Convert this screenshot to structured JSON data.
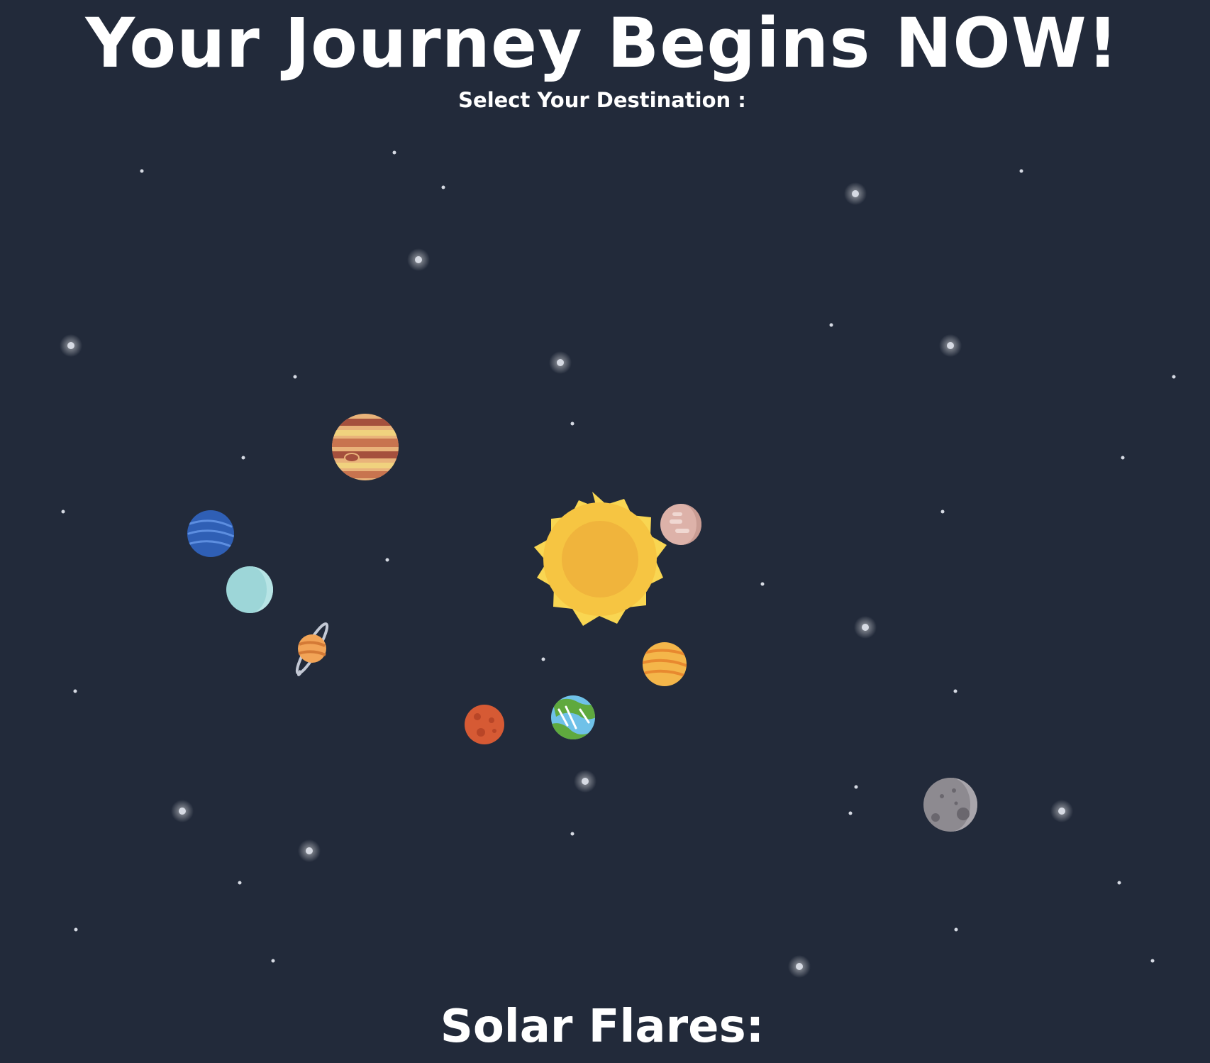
{
  "header": {
    "title": "Your Journey Begins NOW!",
    "subtitle": "Select Your Destination :"
  },
  "solar_system": {
    "sun": {
      "icon": "sun-icon"
    },
    "planets": [
      {
        "icon": "mercury-planet-icon"
      },
      {
        "icon": "venus-planet-icon"
      },
      {
        "icon": "earth-planet-icon"
      },
      {
        "icon": "mars-planet-icon"
      },
      {
        "icon": "jupiter-planet-icon"
      },
      {
        "icon": "saturn-planet-icon"
      },
      {
        "icon": "uranus-planet-icon"
      },
      {
        "icon": "neptune-planet-icon"
      },
      {
        "icon": "moon-icon"
      }
    ]
  },
  "sections": {
    "solar_flares_heading": "Solar Flares:"
  },
  "colors": {
    "background": "#222a3a",
    "text": "#ffffff",
    "sun_core": "#f3b63b",
    "sun_rays": "#f9d652"
  }
}
